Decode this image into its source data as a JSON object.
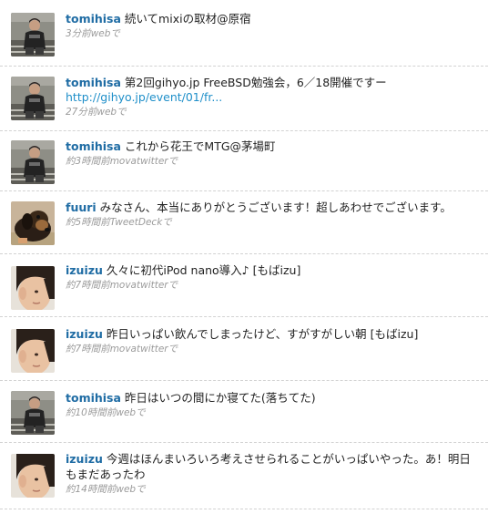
{
  "tweets": [
    {
      "user": "tomihisa",
      "avatar": "tomihisa-avatar",
      "text": "続いてmixiの取材@原宿",
      "link": "",
      "time": "3分前",
      "source": "web",
      "suffix": "で"
    },
    {
      "user": "tomihisa",
      "avatar": "tomihisa-avatar",
      "text": "第2回gihyo.jp FreeBSD勉強会，6／18開催ですー",
      "link": "http://gihyo.jp/event/01/fr...",
      "time": "27分前",
      "source": "web",
      "suffix": "で"
    },
    {
      "user": "tomihisa",
      "avatar": "tomihisa-avatar",
      "text": "これから花王でMTG@茅場町",
      "link": "",
      "time": "約3時間前",
      "source": "movatwitter",
      "suffix": "で"
    },
    {
      "user": "fuuri",
      "avatar": "fuuri-avatar",
      "text": "みなさん、本当にありがとうございます！超しあわせでございます。",
      "link": "",
      "time": "約5時間前",
      "source": "TweetDeck",
      "suffix": "で"
    },
    {
      "user": "izuizu",
      "avatar": "izuizu-avatar",
      "text": "久々に初代iPod nano導入♪ [もばizu]",
      "link": "",
      "time": "約7時間前",
      "source": "movatwitter",
      "suffix": "で"
    },
    {
      "user": "izuizu",
      "avatar": "izuizu-avatar",
      "text": "昨日いっぱい飲んでしまったけど、すがすがしい朝 [もばizu]",
      "link": "",
      "time": "約7時間前",
      "source": "movatwitter",
      "suffix": "で"
    },
    {
      "user": "tomihisa",
      "avatar": "tomihisa-avatar",
      "text": "昨日はいつの間にか寝てた(落ちてた)",
      "link": "",
      "time": "約10時間前",
      "source": "web",
      "suffix": "で"
    },
    {
      "user": "izuizu",
      "avatar": "izuizu-avatar",
      "text": "今週はほんまいろいろ考えさせられることがいっぱいやった。あ！明日もまだあったわ",
      "link": "",
      "time": "約14時間前",
      "source": "web",
      "suffix": "で"
    }
  ],
  "colors": {
    "screen_name": "#1f6ca4",
    "link": "#1f8fc9",
    "meta": "#9b9b9b",
    "divider": "#d2d2d2"
  }
}
